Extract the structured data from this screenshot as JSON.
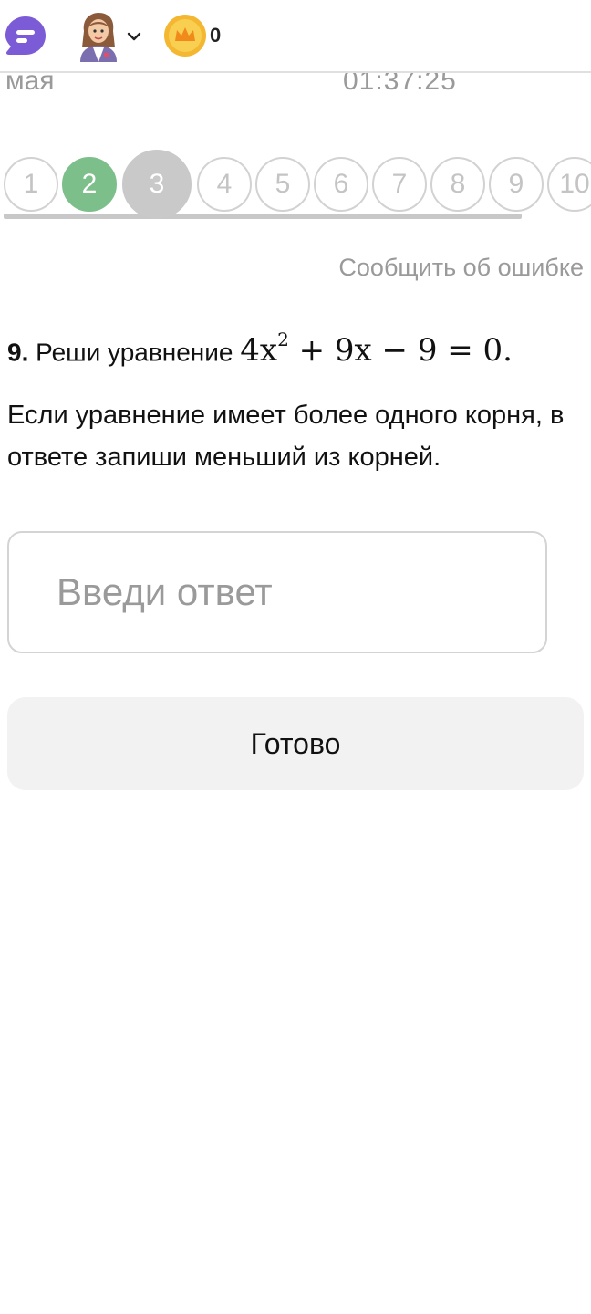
{
  "header": {
    "chat_icon": "chat-bubble-icon",
    "avatar_icon": "teacher-avatar-icon",
    "dropdown_icon": "chevron-down-icon",
    "coin_icon": "crown-coin-icon",
    "coin_count": "0"
  },
  "session": {
    "date_fragment": "мая",
    "timer": "01:37:25"
  },
  "progress": {
    "questions": [
      {
        "label": "1",
        "state": "default"
      },
      {
        "label": "2",
        "state": "done"
      },
      {
        "label": "3",
        "state": "current"
      },
      {
        "label": "4",
        "state": "default"
      },
      {
        "label": "5",
        "state": "default"
      },
      {
        "label": "6",
        "state": "default"
      },
      {
        "label": "7",
        "state": "default"
      },
      {
        "label": "8",
        "state": "default"
      },
      {
        "label": "9",
        "state": "default"
      },
      {
        "label": "10",
        "state": "default"
      }
    ]
  },
  "report_link": "Сообщить об ошибке",
  "question": {
    "number": "9.",
    "text": "Реши уравнение",
    "equation_part1": "4x",
    "equation_exp": "2",
    "equation_part2": "+ 9x − 9 = 0.",
    "instruction": "Если уравнение имеет более одного корня, в ответе запиши меньший из корней."
  },
  "answer": {
    "placeholder": "Введи ответ",
    "value": ""
  },
  "submit_label": "Готово",
  "colors": {
    "done": "#7cbf8a",
    "current": "#c9c9c9",
    "chat_accent": "#7b5bd6",
    "coin": "#f4b731"
  }
}
